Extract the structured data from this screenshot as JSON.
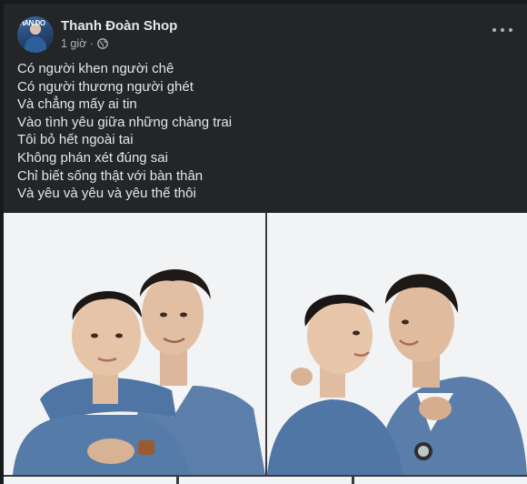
{
  "post": {
    "author": "Thanh Đoàn Shop",
    "time": "1 giờ ·",
    "avatar_text": "HAN ĐO",
    "caption_lines": [
      "Có người khen người chê",
      "Có người thương người ghét",
      "Và chẳng mấy ai tin",
      "Vào tình yêu giữa những chàng trai",
      "Tôi bỏ hết ngoài tai",
      "Không phán xét đúng sai",
      "Chỉ biết sống thật với bàn thân",
      "Và yêu và yêu và yêu thế thôi"
    ],
    "icons": {
      "privacy": "globe-icon",
      "menu": "more-options-icon"
    }
  },
  "colors": {
    "page_bg": "#18191a",
    "card_bg": "#242526",
    "primary_text": "#e4e6eb",
    "secondary_text": "#b0b3b8",
    "photo_bg": "#f2f3f5",
    "denim": "#4a6f9c"
  }
}
